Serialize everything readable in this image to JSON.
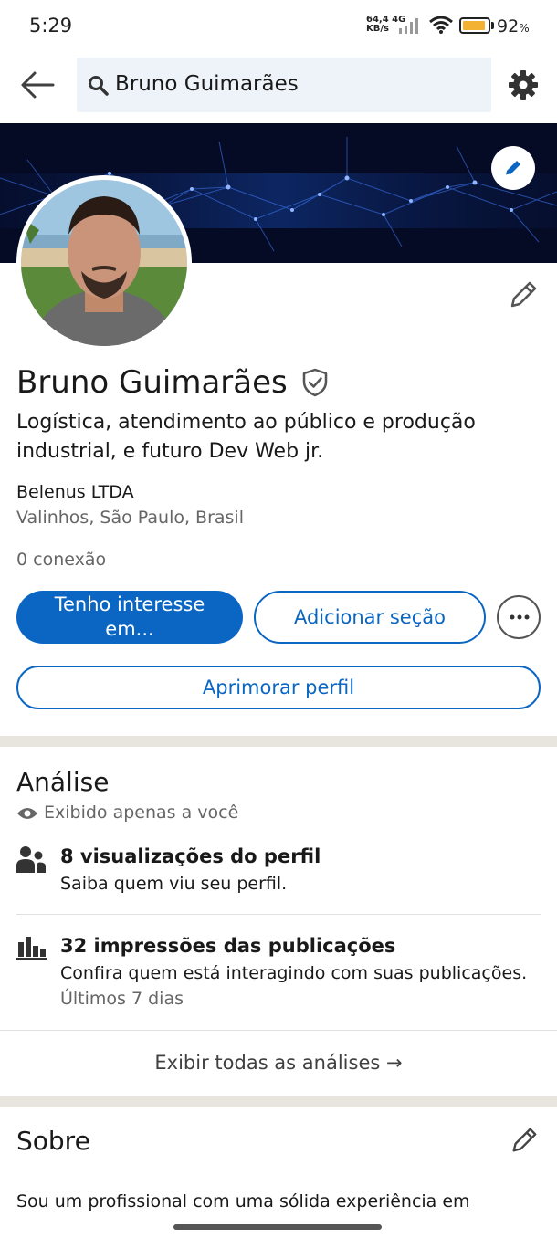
{
  "status_bar": {
    "time": "5:29",
    "network_speed": "64,4",
    "network_unit": "KB/s",
    "network_type": "4G",
    "battery_percent": "92",
    "battery_unit": "%",
    "battery_level": 0.92,
    "battery_color": "#f4b233"
  },
  "header": {
    "back_icon": "arrow-left-icon",
    "search_icon": "search-icon",
    "search_value": "Bruno Guimarães",
    "settings_icon": "gear-icon"
  },
  "profile": {
    "name": "Bruno Guimarães",
    "verified_icon": "shield-check-icon",
    "headline": "Logística, atendimento ao público e produção industrial, e futuro Dev Web jr.",
    "company": "Belenus LTDA",
    "location": "Valinhos, São Paulo, Brasil",
    "connections": "0 conexão",
    "buttons": {
      "primary_line1": "Tenho interesse",
      "primary_line2": "em...",
      "add_section": "Adicionar seção",
      "improve": "Aprimorar perfil"
    }
  },
  "analytics": {
    "title": "Análise",
    "private_note": "Exibido apenas a você",
    "items": [
      {
        "icon": "people-icon",
        "title": "8 visualizações do perfil",
        "subtitle": "Saiba quem viu seu perfil."
      },
      {
        "icon": "bar-chart-icon",
        "title": "32 impressões das publicações",
        "subtitle": "Confira quem está interagindo com suas publicações.",
        "note": "Últimos 7 dias"
      }
    ],
    "show_all": "Exibir todas as análises →"
  },
  "about": {
    "title": "Sobre",
    "text": "Sou um profissional com uma sólida experiência em"
  },
  "colors": {
    "brand_blue": "#0a66c2",
    "banner_bg": "#050b25",
    "divider": "#e8e5df"
  }
}
